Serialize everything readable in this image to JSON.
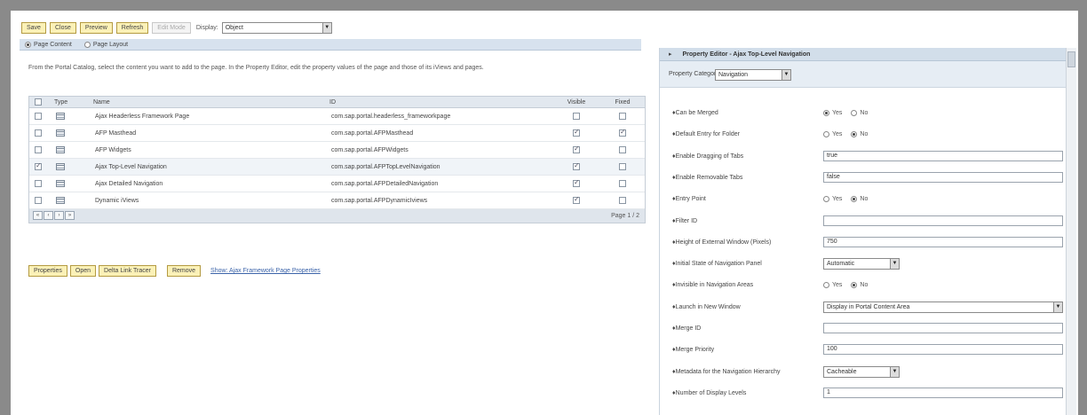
{
  "toolbar": {
    "buttons": [
      "Save",
      "Close",
      "Preview",
      "Refresh",
      "Edit Mode"
    ],
    "display_label": "Display:",
    "display_value": "Object"
  },
  "tabs": {
    "page_content": "Page Content",
    "page_layout": "Page Layout"
  },
  "intro_text": "From the Portal Catalog, select the content you want to add to the page. In the Property Editor, edit the property values of the page and those of its iViews and pages.",
  "grid": {
    "headers": {
      "type": "Type",
      "name": "Name",
      "id": "ID",
      "visible": "Visible",
      "fixed": "Fixed"
    },
    "rows": [
      {
        "name": "Ajax Headerless Framework Page",
        "id": "com.sap.portal.headerless_frameworkpage",
        "selected": false,
        "visible": false,
        "fixed": false
      },
      {
        "name": "AFP Masthead",
        "id": "com.sap.portal.AFPMasthead",
        "selected": false,
        "visible": true,
        "fixed": true
      },
      {
        "name": "AFP Widgets",
        "id": "com.sap.portal.AFPWidgets",
        "selected": false,
        "visible": true,
        "fixed": false
      },
      {
        "name": "Ajax Top-Level Navigation",
        "id": "com.sap.portal.AFPTopLevelNavigation",
        "selected": true,
        "visible": true,
        "fixed": false
      },
      {
        "name": "Ajax Detailed Navigation",
        "id": "com.sap.portal.AFPDetailedNavigation",
        "selected": false,
        "visible": true,
        "fixed": false
      },
      {
        "name": "Dynamic iViews",
        "id": "com.sap.portal.AFPDynamicIviews",
        "selected": false,
        "visible": true,
        "fixed": false
      }
    ],
    "page_label": "Page 1 / 2"
  },
  "actions": {
    "buttons": [
      "Properties",
      "Open",
      "Delta Link Tracer"
    ],
    "remove": "Remove",
    "link": "Show: Ajax Framework Page Properties"
  },
  "property_editor": {
    "title": "Property Editor - Ajax Top-Level Navigation",
    "category_label": "Property Category:",
    "category_value": "Navigation",
    "yes_label": "Yes",
    "no_label": "No",
    "props": [
      {
        "label": "Can be Merged",
        "kind": "yesno",
        "value": "Yes"
      },
      {
        "label": "Default Entry for Folder",
        "kind": "yesno",
        "value": "No"
      },
      {
        "label": "Enable Dragging of Tabs",
        "kind": "text",
        "value": "true"
      },
      {
        "label": "Enable Removable Tabs",
        "kind": "text",
        "value": "false"
      },
      {
        "label": "Entry Point",
        "kind": "yesno",
        "value": "No"
      },
      {
        "label": "Filter ID",
        "kind": "text",
        "value": ""
      },
      {
        "label": "Height of External Window (Pixels)",
        "kind": "text",
        "value": "750"
      },
      {
        "label": "Initial State of Navigation Panel",
        "kind": "select",
        "value": "Automatic"
      },
      {
        "label": "Invisible in Navigation Areas",
        "kind": "yesno",
        "value": "No"
      },
      {
        "label": "Launch in New Window",
        "kind": "selectwide",
        "value": "Display in Portal Content Area"
      },
      {
        "label": "Merge ID",
        "kind": "text",
        "value": ""
      },
      {
        "label": "Merge Priority",
        "kind": "text",
        "value": "100"
      },
      {
        "label": "Metadata for the Navigation Hierarchy",
        "kind": "select",
        "value": "Cacheable"
      },
      {
        "label": "Number of Display Levels",
        "kind": "text",
        "value": "1"
      }
    ]
  }
}
